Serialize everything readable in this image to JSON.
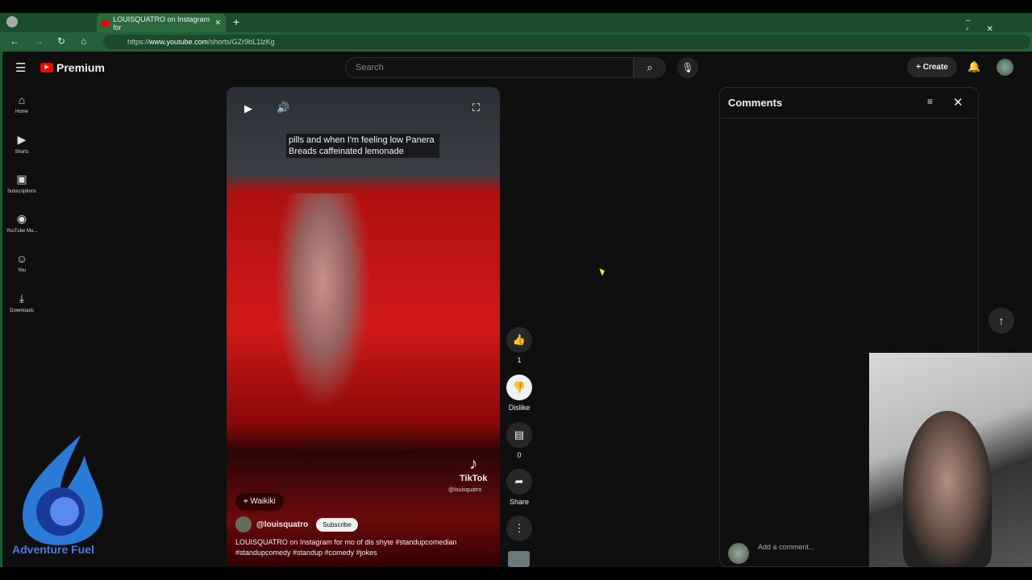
{
  "browser": {
    "tab_title": "LOUISQUATRO on Instagram for",
    "url_prefix": "https://",
    "url_domain": "www.youtube.com",
    "url_path": "/shorts/GZr9bL1lzKg"
  },
  "header": {
    "logo": "Premium",
    "search_placeholder": "Search",
    "create": "Create"
  },
  "sidebar": [
    {
      "label": "Home",
      "icon": "⌂"
    },
    {
      "label": "Shorts",
      "icon": "▶"
    },
    {
      "label": "Subscriptions",
      "icon": "▣"
    },
    {
      "label": "YouTube Mu...",
      "icon": "◉"
    },
    {
      "label": "You",
      "icon": "☺"
    },
    {
      "label": "Downloads",
      "icon": "⤓"
    }
  ],
  "video": {
    "caption": "pills and when I'm feeling low Panera Breads caffeinated lemonade",
    "watermark": "TikTok",
    "watermark_user": "@louisquatro",
    "location": "Waikiki",
    "channel": "@louisquatro",
    "subscribe": "Subscribe",
    "description": "LOUISQUATRO on Instagram for mo of dis shyte #standupcomedian #standupcomedy #standup #comedy #jokes"
  },
  "actions": {
    "likes": "1",
    "dislike": "Dislike",
    "comments": "0",
    "share": "Share"
  },
  "comments": {
    "title": "Comments",
    "add_placeholder": "Add a comment..."
  },
  "branding": {
    "text": "Adventure Fuel"
  }
}
